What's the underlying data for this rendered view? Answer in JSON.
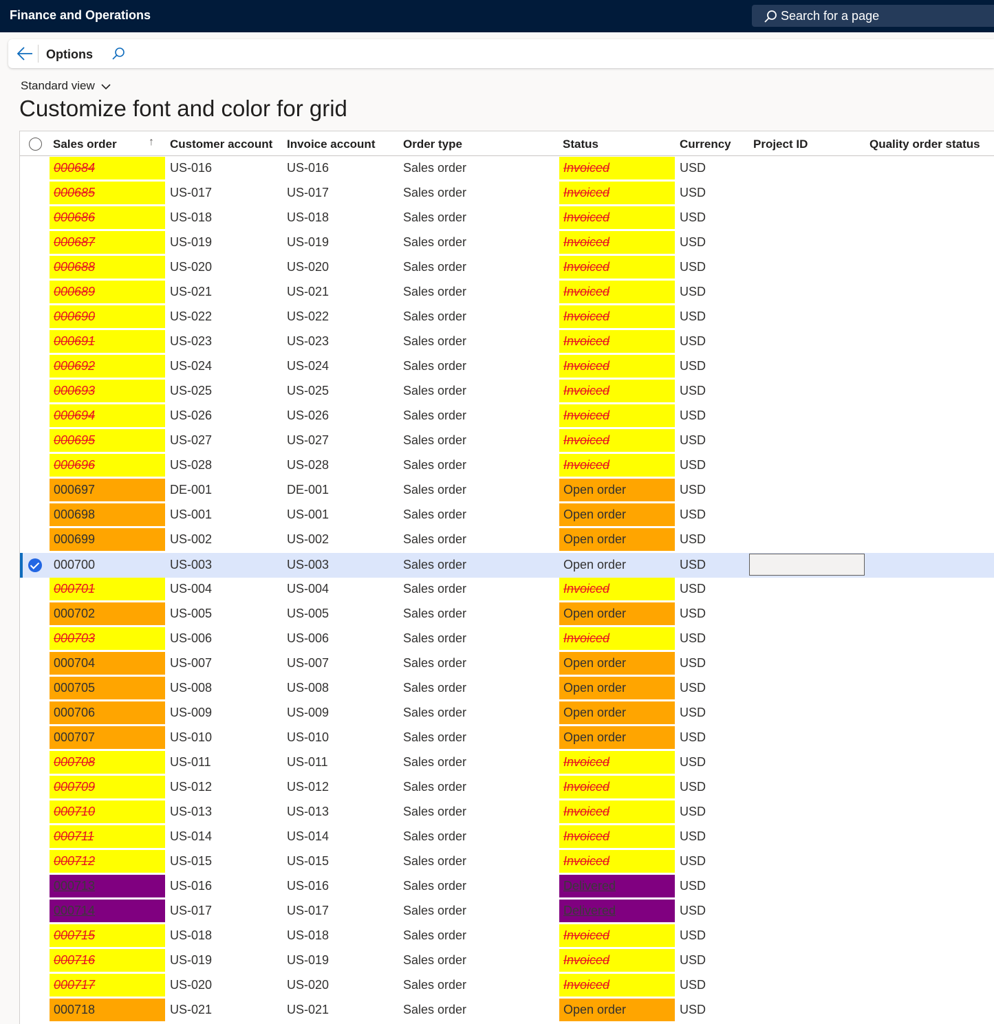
{
  "app": {
    "title": "Finance and Operations",
    "search_placeholder": "Search for a page"
  },
  "actionbar": {
    "options_label": "Options"
  },
  "view": {
    "name": "Standard view"
  },
  "page": {
    "title": "Customize font and color for grid"
  },
  "colors": {
    "invoiced_bg": "#ffff00",
    "invoiced_fg": "#e81123",
    "open_bg": "#ffa500",
    "delivered_bg": "#800080",
    "selected_row": "#dce6fb",
    "accent": "#0f6cbd"
  },
  "grid": {
    "columns": [
      "Sales order",
      "Customer account",
      "Invoice account",
      "Order type",
      "Status",
      "Currency",
      "Project ID",
      "Quality order status"
    ],
    "rows": [
      {
        "so": "000684",
        "ca": "US-016",
        "ia": "US-016",
        "ot": "Sales order",
        "st": "Invoiced",
        "cu": "USD"
      },
      {
        "so": "000685",
        "ca": "US-017",
        "ia": "US-017",
        "ot": "Sales order",
        "st": "Invoiced",
        "cu": "USD"
      },
      {
        "so": "000686",
        "ca": "US-018",
        "ia": "US-018",
        "ot": "Sales order",
        "st": "Invoiced",
        "cu": "USD"
      },
      {
        "so": "000687",
        "ca": "US-019",
        "ia": "US-019",
        "ot": "Sales order",
        "st": "Invoiced",
        "cu": "USD"
      },
      {
        "so": "000688",
        "ca": "US-020",
        "ia": "US-020",
        "ot": "Sales order",
        "st": "Invoiced",
        "cu": "USD"
      },
      {
        "so": "000689",
        "ca": "US-021",
        "ia": "US-021",
        "ot": "Sales order",
        "st": "Invoiced",
        "cu": "USD"
      },
      {
        "so": "000690",
        "ca": "US-022",
        "ia": "US-022",
        "ot": "Sales order",
        "st": "Invoiced",
        "cu": "USD"
      },
      {
        "so": "000691",
        "ca": "US-023",
        "ia": "US-023",
        "ot": "Sales order",
        "st": "Invoiced",
        "cu": "USD"
      },
      {
        "so": "000692",
        "ca": "US-024",
        "ia": "US-024",
        "ot": "Sales order",
        "st": "Invoiced",
        "cu": "USD"
      },
      {
        "so": "000693",
        "ca": "US-025",
        "ia": "US-025",
        "ot": "Sales order",
        "st": "Invoiced",
        "cu": "USD"
      },
      {
        "so": "000694",
        "ca": "US-026",
        "ia": "US-026",
        "ot": "Sales order",
        "st": "Invoiced",
        "cu": "USD"
      },
      {
        "so": "000695",
        "ca": "US-027",
        "ia": "US-027",
        "ot": "Sales order",
        "st": "Invoiced",
        "cu": "USD"
      },
      {
        "so": "000696",
        "ca": "US-028",
        "ia": "US-028",
        "ot": "Sales order",
        "st": "Invoiced",
        "cu": "USD"
      },
      {
        "so": "000697",
        "ca": "DE-001",
        "ia": "DE-001",
        "ot": "Sales order",
        "st": "Open order",
        "cu": "USD"
      },
      {
        "so": "000698",
        "ca": "US-001",
        "ia": "US-001",
        "ot": "Sales order",
        "st": "Open order",
        "cu": "USD"
      },
      {
        "so": "000699",
        "ca": "US-002",
        "ia": "US-002",
        "ot": "Sales order",
        "st": "Open order",
        "cu": "USD"
      },
      {
        "so": "000700",
        "ca": "US-003",
        "ia": "US-003",
        "ot": "Sales order",
        "st": "Open order",
        "cu": "USD",
        "selected": true
      },
      {
        "so": "000701",
        "ca": "US-004",
        "ia": "US-004",
        "ot": "Sales order",
        "st": "Invoiced",
        "cu": "USD"
      },
      {
        "so": "000702",
        "ca": "US-005",
        "ia": "US-005",
        "ot": "Sales order",
        "st": "Open order",
        "cu": "USD"
      },
      {
        "so": "000703",
        "ca": "US-006",
        "ia": "US-006",
        "ot": "Sales order",
        "st": "Invoiced",
        "cu": "USD"
      },
      {
        "so": "000704",
        "ca": "US-007",
        "ia": "US-007",
        "ot": "Sales order",
        "st": "Open order",
        "cu": "USD"
      },
      {
        "so": "000705",
        "ca": "US-008",
        "ia": "US-008",
        "ot": "Sales order",
        "st": "Open order",
        "cu": "USD"
      },
      {
        "so": "000706",
        "ca": "US-009",
        "ia": "US-009",
        "ot": "Sales order",
        "st": "Open order",
        "cu": "USD"
      },
      {
        "so": "000707",
        "ca": "US-010",
        "ia": "US-010",
        "ot": "Sales order",
        "st": "Open order",
        "cu": "USD"
      },
      {
        "so": "000708",
        "ca": "US-011",
        "ia": "US-011",
        "ot": "Sales order",
        "st": "Invoiced",
        "cu": "USD"
      },
      {
        "so": "000709",
        "ca": "US-012",
        "ia": "US-012",
        "ot": "Sales order",
        "st": "Invoiced",
        "cu": "USD"
      },
      {
        "so": "000710",
        "ca": "US-013",
        "ia": "US-013",
        "ot": "Sales order",
        "st": "Invoiced",
        "cu": "USD"
      },
      {
        "so": "000711",
        "ca": "US-014",
        "ia": "US-014",
        "ot": "Sales order",
        "st": "Invoiced",
        "cu": "USD"
      },
      {
        "so": "000712",
        "ca": "US-015",
        "ia": "US-015",
        "ot": "Sales order",
        "st": "Invoiced",
        "cu": "USD"
      },
      {
        "so": "000713",
        "ca": "US-016",
        "ia": "US-016",
        "ot": "Sales order",
        "st": "Delivered",
        "cu": "USD"
      },
      {
        "so": "000714",
        "ca": "US-017",
        "ia": "US-017",
        "ot": "Sales order",
        "st": "Delivered",
        "cu": "USD"
      },
      {
        "so": "000715",
        "ca": "US-018",
        "ia": "US-018",
        "ot": "Sales order",
        "st": "Invoiced",
        "cu": "USD"
      },
      {
        "so": "000716",
        "ca": "US-019",
        "ia": "US-019",
        "ot": "Sales order",
        "st": "Invoiced",
        "cu": "USD"
      },
      {
        "so": "000717",
        "ca": "US-020",
        "ia": "US-020",
        "ot": "Sales order",
        "st": "Invoiced",
        "cu": "USD"
      },
      {
        "so": "000718",
        "ca": "US-021",
        "ia": "US-021",
        "ot": "Sales order",
        "st": "Open order",
        "cu": "USD"
      }
    ]
  }
}
